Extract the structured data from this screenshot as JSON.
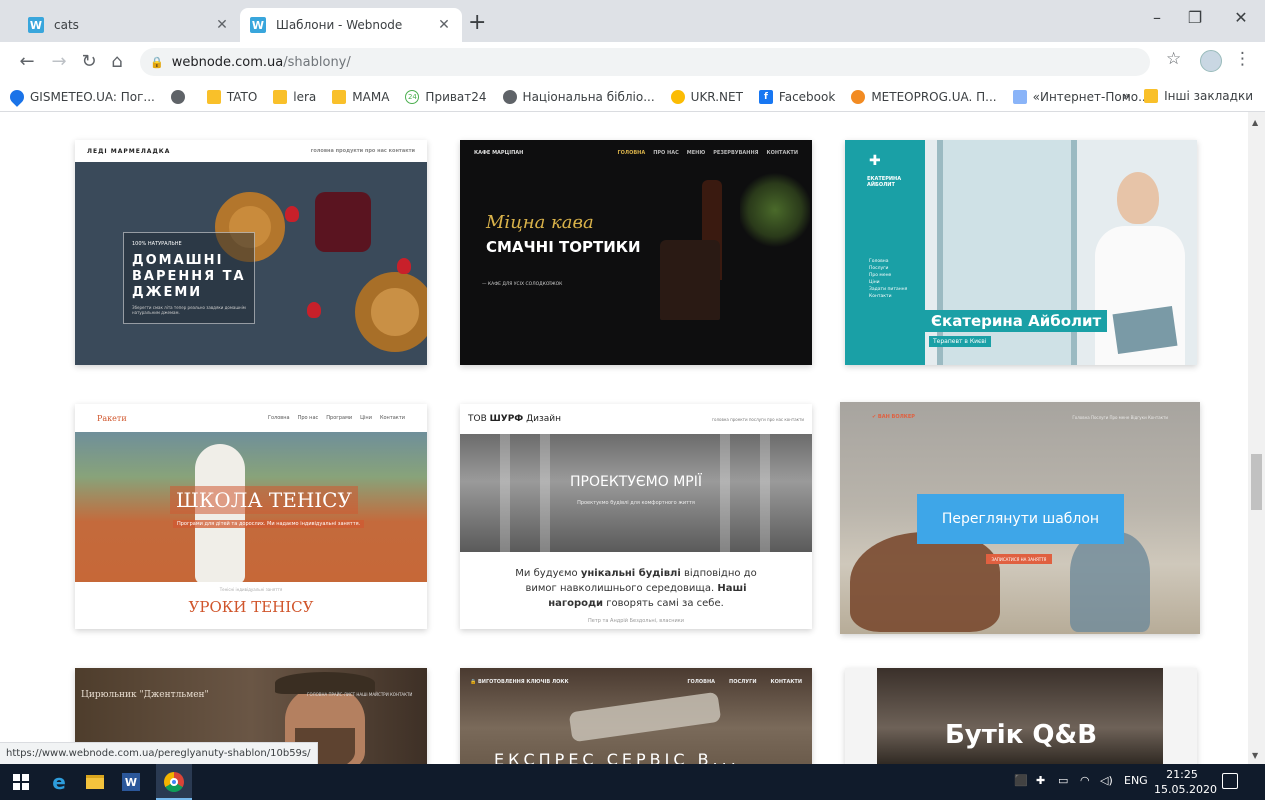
{
  "browser": {
    "tabs": [
      {
        "favicon": "W",
        "title": "cats",
        "close": "✕"
      },
      {
        "favicon": "W",
        "title": "Шаблони - Webnode",
        "close": "✕"
      }
    ],
    "new_tab": "+",
    "window_controls": {
      "minimize": "–",
      "restore": "❐",
      "close": "✕"
    },
    "url_host": "webnode.com.ua",
    "url_path": "/shablony/",
    "status_url": "https://www.webnode.com.ua/pereglyanuty-shablon/10b59s/"
  },
  "bookmarks": [
    {
      "icon": "drop-icon",
      "label": "GISMETEO.UA: Пог..."
    },
    {
      "icon": "globe-icon",
      "label": ""
    },
    {
      "icon": "folder-icon",
      "label": "TATO"
    },
    {
      "icon": "folder-icon",
      "label": "lera"
    },
    {
      "icon": "folder-icon",
      "label": "MAMA"
    },
    {
      "icon": "privat24-icon",
      "label": "Приват24",
      "badge": "24"
    },
    {
      "icon": "globe-icon",
      "label": "Національна бібліо..."
    },
    {
      "icon": "ukrnet-icon",
      "label": "UKR.NET"
    },
    {
      "icon": "facebook-icon",
      "label": "Facebook",
      "badge": "f"
    },
    {
      "icon": "meteoprog-icon",
      "label": "METEOPROG.UA. П..."
    },
    {
      "icon": "doc-icon",
      "label": "«Интернет-Помо..."
    }
  ],
  "bookmarks_overflow": "»",
  "bookmarks_other": "Інші закладки",
  "templates": {
    "t1": {
      "brand": "ЛЕДІ МАРМЕЛАДКА",
      "nav": "головна   продукти   про нас   контакти",
      "small": "100% НАТУРАЛЬНЕ",
      "headline": "ДОМАШНІ ВАРЕННЯ ТА ДЖЕМИ",
      "desc": "Зберегти смак літа тепер реально завдяки домашнім натуральним джемам."
    },
    "t2": {
      "brand": "КАФЕ МАРЦІПАН",
      "nav": [
        "ГОЛОВНА",
        "ПРО НАС",
        "МЕНЮ",
        "РЕЗЕРВУВАННЯ",
        "КОНТАКТИ"
      ],
      "script": "Міцна кава",
      "headline": "СМАЧНІ ТОРТИКИ",
      "sub": "—  КАФЕ ДЛЯ УСІХ СОЛОДКОЇЖОК"
    },
    "t3": {
      "brand": "ЕКАТЕРИНА АЙБОЛИТ",
      "menu": "Головна\nПослуги\nПро мене\nЦіни\nЗадати питання\nКонтакти",
      "headline": "Єкатерина Айболит",
      "sub": "Терапевт в Києві"
    },
    "t4": {
      "brand": "Ракети",
      "nav": [
        "Головна",
        "Про нас",
        "Програми",
        "Ціни",
        "Контакти"
      ],
      "headline": "ШКОЛА ТЕНІСУ",
      "tag": "Програми для дітей та дорослих. Ми надаємо індивідуальні заняття.",
      "small": "Тенісні індивідуальні заняття",
      "lower_title": "УРОКИ ТЕНІСУ"
    },
    "t5": {
      "brand_prefix": "ТОВ",
      "brand_bold": "ШУРФ",
      "brand_suffix": "Дизайн",
      "nav": "головна  проекти  послуги  про нас  контакти",
      "headline": "ПРОЕКТУЄМО МРІЇ",
      "sub": "Проектуємо будівлі для комфортного життя",
      "body_1": "Ми будуємо ",
      "body_bold_1": "унікальні будівлі",
      "body_2": " відповідно до вимог навколишнього середовища. ",
      "body_bold_2": "Наші нагороди",
      "body_3": " говорять самі за себе.",
      "author": "Петр та Андрій Бездольні, власники"
    },
    "t6": {
      "brand": "✔ ВАН ВОЛКЕР",
      "nav": "Головна  Послуги  Про мене  Відгуки  Контакти",
      "view_button": "Переглянути шаблон",
      "small_button": "ЗАПИСАТИСЯ НА ЗАНЯТТЯ"
    },
    "t7": {
      "brand": "Цирюльник \"Джентльмен\"",
      "nav": "ГОЛОВНА  ПРАЙС-ЛИСТ  НАШІ МАЙСТРИ  КОНТАКТИ"
    },
    "t8": {
      "brand": "🔒 ВИГОТОВЛЕННЯ КЛЮЧІВ ЛОКК",
      "nav": [
        "ГОЛОВНА",
        "ПОСЛУГИ",
        "КОНТАКТИ"
      ],
      "headline": "ЕКСПРЕС СЕРВІС В..."
    },
    "t9": {
      "headline": "Бутік Q&B"
    }
  },
  "taskbar": {
    "language": "ENG",
    "time": "21:25",
    "date": "15.05.2020"
  },
  "colors": {
    "webnode_blue": "#3ea6e8",
    "teal": "#1aa0a6",
    "tennis_orange": "#d0552b",
    "taskbar": "#101b2b"
  }
}
